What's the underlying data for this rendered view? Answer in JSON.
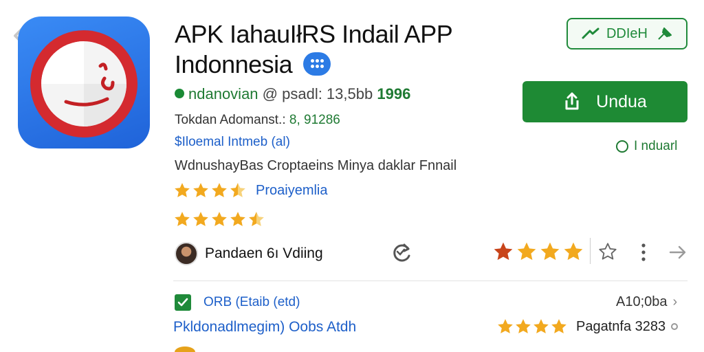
{
  "app": {
    "title_line1": "APK IahauIłRS Indail APP",
    "title_line2": "Indonnesia",
    "developer": "ndanovian",
    "developer_meta": "@ psadl: 13,5bb",
    "developer_number": "1996",
    "meta_line1_label": "Tokdan Adomanst.:",
    "meta_line1_value": "8, 91286",
    "meta_line2": "$Iloemal Intmeb (al)",
    "meta_line3": "WdnushayBas Croptaeins Minya daklar Fnnail",
    "rating_label": "Proaiyemlia",
    "rating_value_1": 3.5,
    "rating_value_2": 4.5
  },
  "user": {
    "name": "Pandaen 6ı Vdiing"
  },
  "actions": {
    "install_top_label": "DDIeH",
    "download_label": "Undua",
    "indicator_label": "I nduarl",
    "right_stars": 4
  },
  "list": {
    "row1_label": "ORB (Etaib (etd)",
    "row1_right": "A10;0ba",
    "row2_label": "Pkldonadlmegim) Oobs Atdh",
    "row2_right": "Pagatnfa 3283",
    "row2_stars": 4
  },
  "colors": {
    "accent_green": "#1e8a34",
    "link_blue": "#1d5fc9",
    "star_gold": "#f2a91f",
    "app_icon_blue": "#2a74e6",
    "app_icon_red": "#d42a2f"
  },
  "icons": {
    "back": "chevron-left-icon",
    "app": "app-logo-icon",
    "refresh": "refresh-icon",
    "more": "more-vertical-icon",
    "arrow": "arrow-right-icon",
    "check": "checkbox-checked-icon",
    "download": "download-icon",
    "star": "star-icon"
  }
}
